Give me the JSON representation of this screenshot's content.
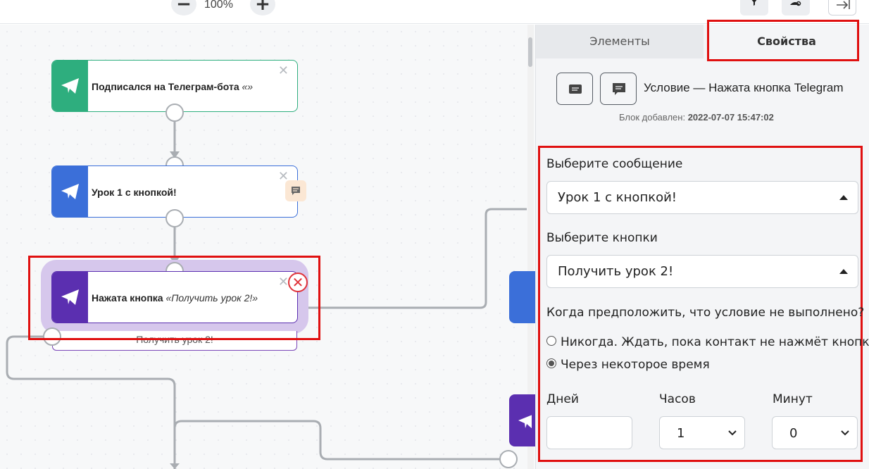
{
  "toolbar": {
    "zoom_out_icon": "minus-icon",
    "zoom_level": "100%",
    "zoom_in_icon": "plus-icon",
    "filter_icon": "filter-icon",
    "user_search_icon": "user-search-icon",
    "exit_icon": "exit-panel-icon"
  },
  "canvas": {
    "nodes": [
      {
        "title": "Подписался на Телеграм-бота",
        "suffix": "«»",
        "color": "#2eae7e"
      },
      {
        "title": "Урок 1 с кнопкой!",
        "suffix": "",
        "color": "#3b6fd9"
      },
      {
        "title": "Нажата кнопка",
        "suffix": "«Получить урок 2!»",
        "color": "#5b2fb0"
      }
    ],
    "button_label": "Получить урок 2!"
  },
  "panel": {
    "tabs": [
      "Элементы",
      "Свойства"
    ],
    "active_tab": "Свойства",
    "block_title": "Условие — Нажата кнопка Telegram",
    "added_label": "Блок добавлен:",
    "added_date": "2022-07-07 15:47:02",
    "message_label": "Выберите сообщение",
    "message_value": "Урок 1 с кнопкой!",
    "buttons_label": "Выберите кнопки",
    "buttons_value": "Получить урок 2!",
    "condition_question": "Когда предположить, что условие не выполнено?",
    "radio_options": [
      {
        "label": "Никогда. Ждать, пока контакт не нажмёт кнопку",
        "checked": false
      },
      {
        "label": "Через некоторое время",
        "checked": true
      }
    ],
    "days_label": "Дней",
    "days_value": "",
    "hours_label": "Часов",
    "hours_value": "1",
    "minutes_label": "Минут",
    "minutes_value": "0"
  },
  "colors": {
    "highlight": "#e01010",
    "selected_halo": "#d6c7ec",
    "error": "#e0333a"
  }
}
